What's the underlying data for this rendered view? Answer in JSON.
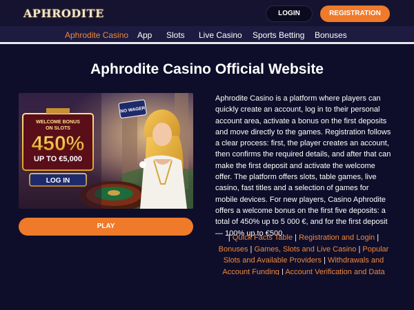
{
  "header": {
    "logo": "APHRODITE",
    "login_label": "LOGIN",
    "registration_label": "REGISTRATION"
  },
  "nav": {
    "items": [
      "Aphrodite Casino",
      "App",
      "Slots",
      "Live Casino",
      "Sports Betting",
      "Bonuses"
    ],
    "active_index": 0
  },
  "main": {
    "title": "Aphrodite Casino Official Website",
    "banner": {
      "badge": "NO WAGER",
      "bonus_line1": "WELCOME BONUS",
      "bonus_line2": "ON SLOTS",
      "percent": "450%",
      "amount": "UP TO €5,000",
      "login_label": "LOG IN"
    },
    "play_label": "PLAY",
    "description": "Aphrodite Casino is a platform where players can quickly create an account, log in to their personal account area, activate a bonus on the first deposits and move directly to the games. Registration follows a clear process: first, the player creates an account, then confirms the required details, and after that can make the first deposit and activate the welcome offer. The platform offers slots, table games, live casino, fast titles and a selection of games for mobile devices. For new players, Casino Aphrodite offers a welcome bonus on the first five deposits: a total of 450% up to 5 000 €, and for the first deposit — 100% up to €500.",
    "links": [
      "Quick Facts Table",
      "Registration and Login",
      "Bonuses",
      "Games, Slots and Live Casino",
      "Popular Slots and Available Providers",
      "Withdrawals and Account Funding",
      "Account Verification and Data Security"
    ],
    "separator": "|"
  },
  "colors": {
    "accent": "#ef7a2a",
    "background": "#0f0e2a",
    "nav_bg": "#1d1b40"
  }
}
